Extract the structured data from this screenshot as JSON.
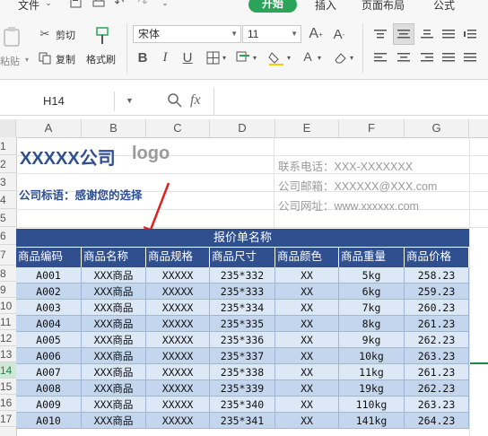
{
  "ribbon": {
    "tabs": [
      "文件",
      "开始",
      "插入",
      "页面布局",
      "公式"
    ],
    "active_tab": "开始",
    "clipboard": {
      "paste": "粘贴",
      "cut": "剪切",
      "copy": "复制",
      "format_painter": "格式刷"
    },
    "font_name": "宋体",
    "font_size": "11",
    "accent": "#2aa458"
  },
  "formula_bar": {
    "cell_ref": "H14",
    "fx": "fx",
    "value": ""
  },
  "columns": [
    "A",
    "B",
    "C",
    "D",
    "E",
    "F",
    "G"
  ],
  "rows": [
    "1",
    "2",
    "3",
    "4",
    "5",
    "6",
    "7",
    "8",
    "9",
    "10",
    "11",
    "12",
    "13",
    "14",
    "15",
    "16",
    "17"
  ],
  "active_row": "14",
  "sheet": {
    "company": "XXXXX公司",
    "logo": "logo",
    "slogan": "公司标语：感谢您的选择",
    "phone": "联系电话：XXX-XXXXXXX",
    "email": "公司邮箱：XXXXXX@XXX.com",
    "website": "公司网址：www.xxxxxx.com",
    "table_title": "报价单名称",
    "headers": [
      "商品编码",
      "商品名称",
      "商品规格",
      "商品尺寸",
      "商品颜色",
      "商品重量",
      "商品价格"
    ],
    "header_color": "#2f4f8f",
    "rows": [
      [
        "A001",
        "XXX商品",
        "XXXXX",
        "235*332",
        "XX",
        "5kg",
        "258.23"
      ],
      [
        "A002",
        "XXX商品",
        "XXXXX",
        "235*333",
        "XX",
        "6kg",
        "259.23"
      ],
      [
        "A003",
        "XXX商品",
        "XXXXX",
        "235*334",
        "XX",
        "7kg",
        "260.23"
      ],
      [
        "A004",
        "XXX商品",
        "XXXXX",
        "235*335",
        "XX",
        "8kg",
        "261.23"
      ],
      [
        "A005",
        "XXX商品",
        "XXXXX",
        "235*336",
        "XX",
        "9kg",
        "262.23"
      ],
      [
        "A006",
        "XXX商品",
        "XXXXX",
        "235*337",
        "XX",
        "10kg",
        "263.23"
      ],
      [
        "A007",
        "XXX商品",
        "XXXXX",
        "235*338",
        "XX",
        "11kg",
        "261.23"
      ],
      [
        "A008",
        "XXX商品",
        "XXXXX",
        "235*339",
        "XX",
        "19kg",
        "262.23"
      ],
      [
        "A009",
        "XXX商品",
        "XXXXX",
        "235*340",
        "XX",
        "110kg",
        "263.23"
      ],
      [
        "A010",
        "XXX商品",
        "XXXXX",
        "235*341",
        "XX",
        "141kg",
        "264.23"
      ]
    ]
  }
}
